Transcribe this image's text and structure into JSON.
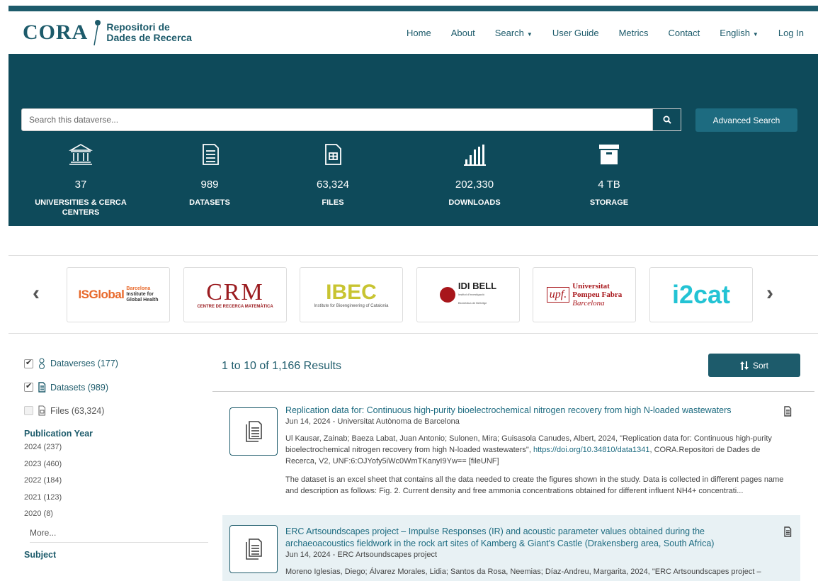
{
  "brand": {
    "logo_text": "CORA",
    "subtitle_line1": "Repositori de",
    "subtitle_line2": "Dades de Recerca"
  },
  "nav": {
    "home": "Home",
    "about": "About",
    "search": "Search",
    "user_guide": "User Guide",
    "metrics": "Metrics",
    "contact": "Contact",
    "language": "English",
    "login": "Log In"
  },
  "search": {
    "placeholder": "Search this dataverse...",
    "advanced_label": "Advanced Search"
  },
  "stats": [
    {
      "icon": "institution-icon",
      "value": "37",
      "label": "UNIVERSITIES & CERCA CENTERS"
    },
    {
      "icon": "datasets-icon",
      "value": "989",
      "label": "DATASETS"
    },
    {
      "icon": "files-icon",
      "value": "63,324",
      "label": "FILES"
    },
    {
      "icon": "downloads-icon",
      "value": "202,330",
      "label": "DOWNLOADS"
    },
    {
      "icon": "storage-icon",
      "value": "4 TB",
      "label": "STORAGE"
    }
  ],
  "logos": {
    "isglobal": {
      "name": "ISGlobal",
      "sub1": "Barcelona",
      "sub2": "Institute for",
      "sub3": "Global Health"
    },
    "crm": {
      "name": "CRM",
      "sub": "CENTRE DE RECERCA MATEMÀTICA"
    },
    "ibec": {
      "name": "IBEC",
      "sub": "Institute for Bioengineering of Catalonia"
    },
    "idibell": {
      "name": "IDI BELL",
      "sub1": "Institut d'Investigació",
      "sub2": "Biomèdica de Bellvitge"
    },
    "upf": {
      "mark": "upf.",
      "line1": "Universitat",
      "line2": "Pompeu Fabra",
      "line3": "Barcelona"
    },
    "i2cat": {
      "name": "i2cat"
    }
  },
  "facets": {
    "dataverses": "Dataverses (177)",
    "datasets": "Datasets (989)",
    "files": "Files (63,324)",
    "publication_year_title": "Publication Year",
    "years": [
      "2024 (237)",
      "2023 (460)",
      "2022 (184)",
      "2021 (123)",
      "2020 (8)"
    ],
    "more": "More...",
    "subject_title": "Subject"
  },
  "results": {
    "count_text": "1 to 10 of 1,166 Results",
    "sort_label": "Sort",
    "items": [
      {
        "title": "Replication data for: Continuous high-purity bioelectrochemical nitrogen recovery from high N-loaded wastewaters",
        "meta": "Jun 14, 2024 - Universitat Autònoma de Barcelona",
        "cite_before": "Ul Kausar, Zainab; Baeza Labat, Juan Antonio; Sulonen, Mira; Guisasola Canudes, Albert, 2024, \"Replication data for: Continuous high-purity bioelectrochemical nitrogen recovery from high N-loaded wastewaters\", ",
        "cite_doi": "https://doi.org/10.34810/data1341",
        "cite_after": ", CORA.Repositori de Dades de Recerca, V2, UNF:6:OJYofy5iWc0WmTKanyI9Yw== [fileUNF]",
        "description": "The dataset is an excel sheet that contains all the data needed to create the figures shown in the study. Data is collected in different pages name and description as follows: Fig. 2. Current density and free ammonia concentrations obtained for different influent NH4+ concentrati..."
      },
      {
        "title": "ERC Artsoundscapes project – Impulse Responses (IR) and acoustic parameter values obtained during the archaeoacoustics fieldwork in the rock art sites of Kamberg & Giant's Castle (Drakensberg area, South Africa)",
        "meta": "Jun 14, 2024 - ERC Artsoundscapes project",
        "cite_before": "Moreno Iglesias, Diego; Álvarez Morales, Lidia; Santos da Rosa, Neemias; Díaz-Andreu, Margarita, 2024, \"ERC Artsoundscapes project –",
        "cite_doi": "",
        "cite_after": "",
        "description": ""
      }
    ]
  },
  "colors": {
    "primary": "#1d5b6b",
    "hero_bg": "#0e4a5a",
    "link": "#1d6b80",
    "alt_row": "#e8f1f4"
  }
}
